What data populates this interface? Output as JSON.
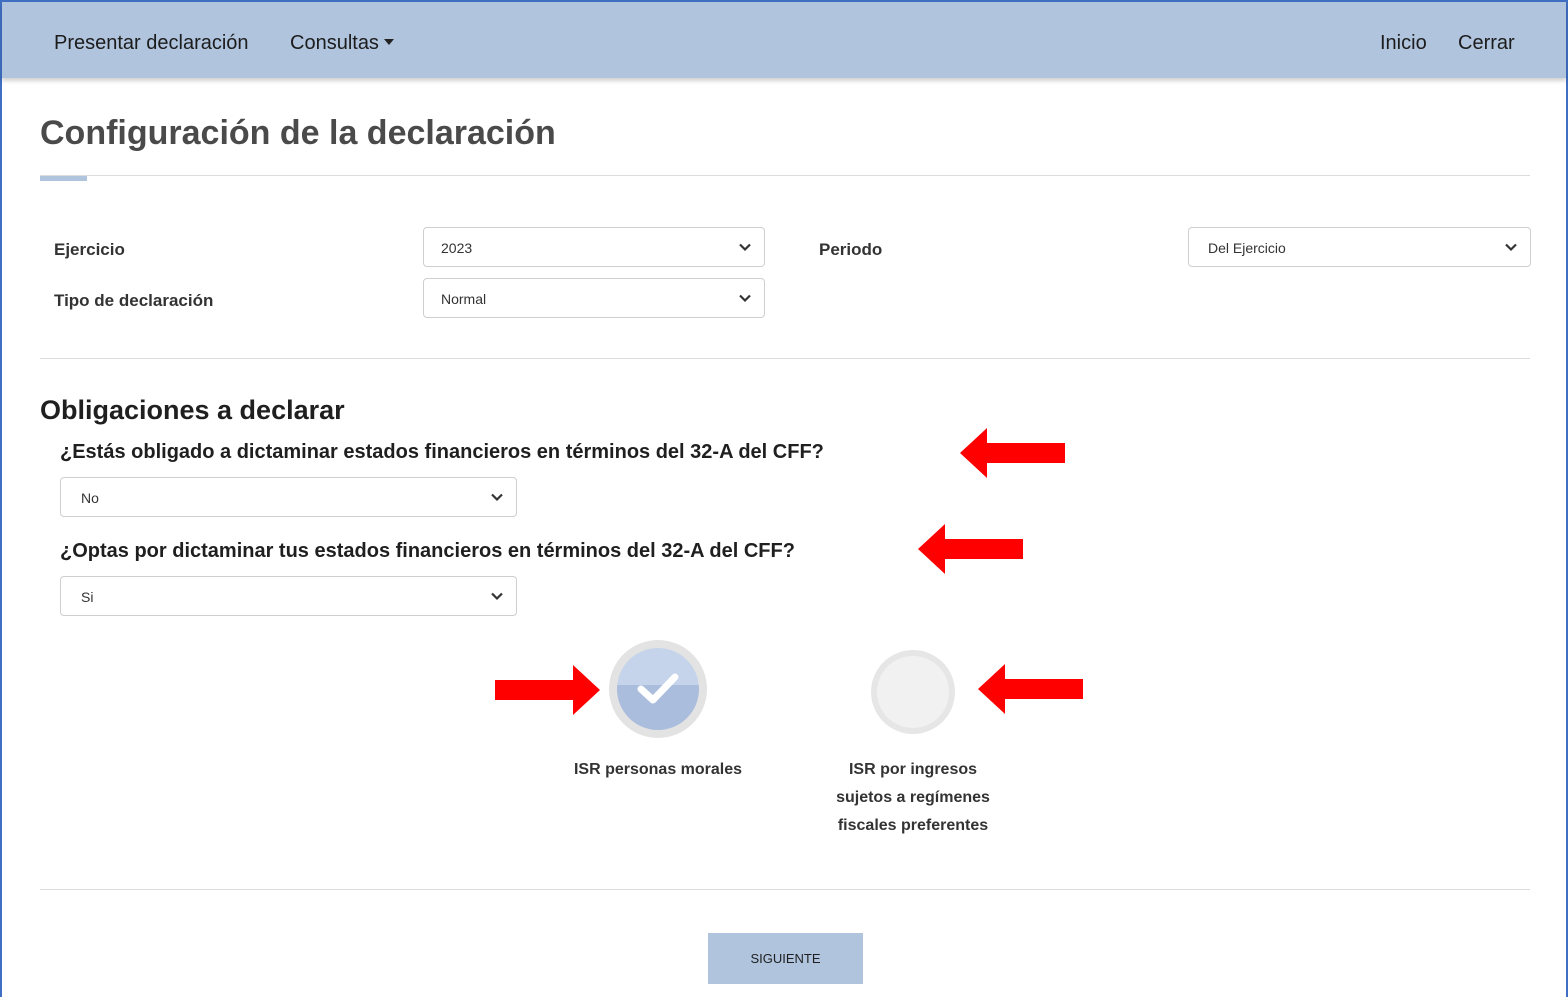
{
  "nav": {
    "presentar": "Presentar declaración",
    "consultas": "Consultas",
    "inicio": "Inicio",
    "cerrar": "Cerrar"
  },
  "page": {
    "title": "Configuración de la declaración"
  },
  "config": {
    "ejercicio_label": "Ejercicio",
    "ejercicio_value": "2023",
    "periodo_label": "Periodo",
    "periodo_value": "Del Ejercicio",
    "tipo_label": "Tipo de declaración",
    "tipo_value": "Normal"
  },
  "obligaciones": {
    "title": "Obligaciones a declarar",
    "q1": "¿Estás obligado a dictaminar estados financieros en términos del 32-A del CFF?",
    "q1_value": "No",
    "q2": "¿Optas por dictaminar tus estados financieros en términos del 32-A del CFF?",
    "q2_value": "Si",
    "options": [
      {
        "label": "ISR personas morales",
        "checked": true
      },
      {
        "label_lines": [
          "ISR por ingresos",
          "sujetos a regímenes",
          "fiscales preferentes"
        ],
        "checked": false
      }
    ]
  },
  "actions": {
    "next": "SIGUIENTE"
  },
  "colors": {
    "navbar": "#b0c4de",
    "accent": "#b0c4de",
    "annotation_arrow": "#ff0000"
  }
}
